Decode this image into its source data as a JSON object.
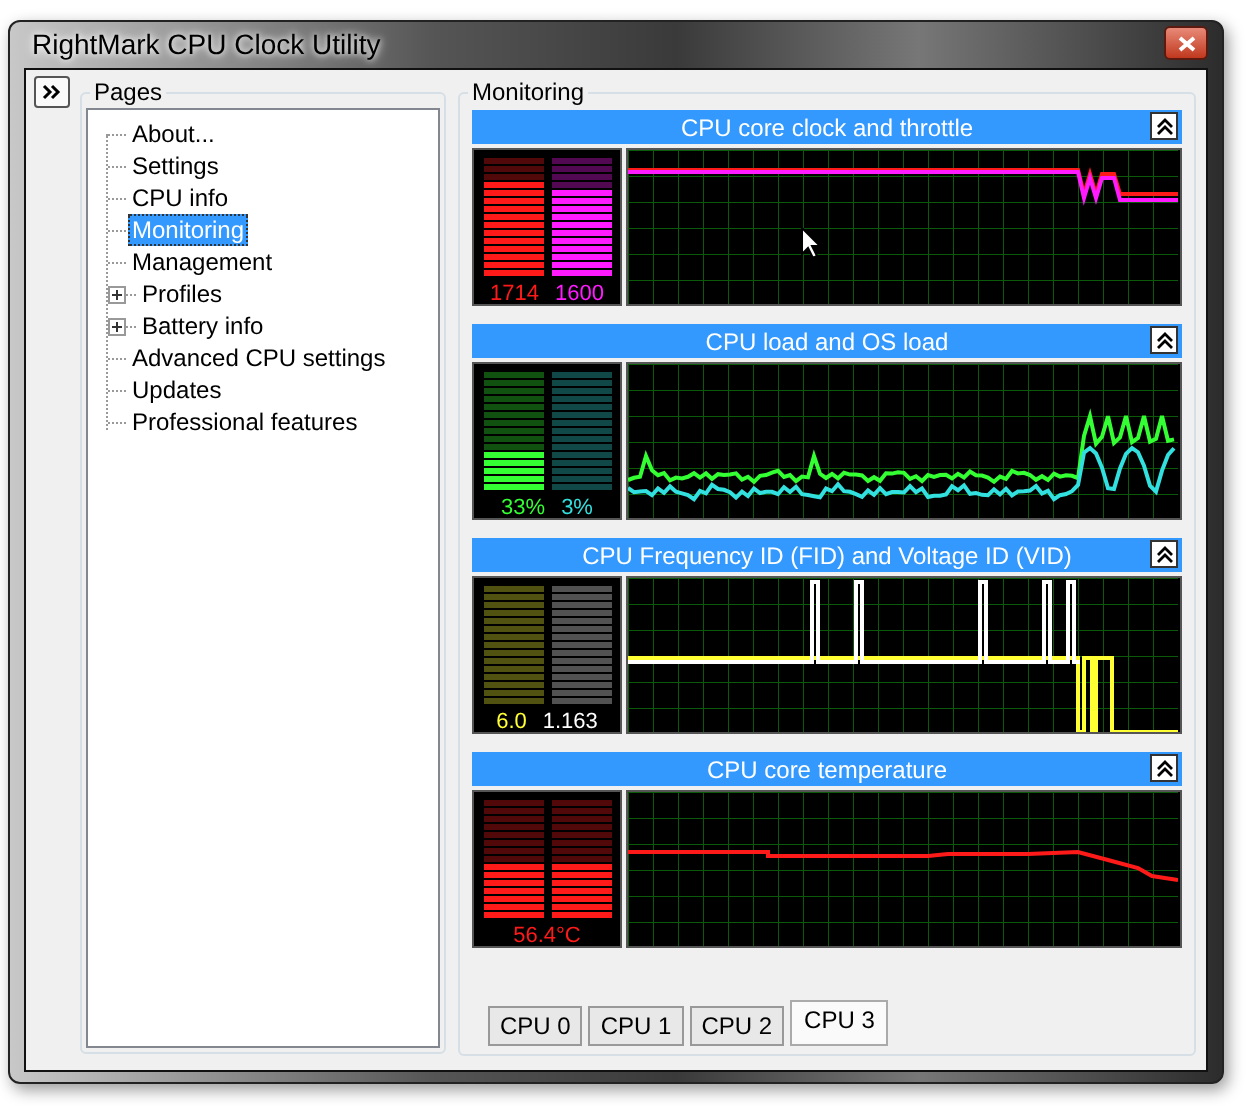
{
  "window": {
    "title": "RightMark CPU Clock Utility"
  },
  "sidebar": {
    "title": "Pages",
    "items": [
      {
        "label": "About...",
        "kind": "page",
        "selected": false
      },
      {
        "label": "Settings",
        "kind": "page",
        "selected": false
      },
      {
        "label": "CPU info",
        "kind": "page",
        "selected": false
      },
      {
        "label": "Monitoring",
        "kind": "page",
        "selected": true
      },
      {
        "label": "Management",
        "kind": "page",
        "selected": false
      },
      {
        "label": "Profiles",
        "kind": "group",
        "expanded": false,
        "selected": false
      },
      {
        "label": "Battery info",
        "kind": "group",
        "expanded": false,
        "selected": false
      },
      {
        "label": "Advanced CPU settings",
        "kind": "page",
        "selected": false
      },
      {
        "label": "Updates",
        "kind": "page",
        "selected": false
      },
      {
        "label": "Professional features",
        "kind": "page",
        "selected": false
      }
    ]
  },
  "monitoring": {
    "title": "Monitoring",
    "panels": [
      {
        "title": "CPU core clock and throttle",
        "meters": [
          {
            "reading": "1714",
            "color": "#ff1a1a",
            "level": 0.82
          },
          {
            "reading": "1600",
            "color": "#ff1aff",
            "level": 0.76
          }
        ]
      },
      {
        "title": "CPU load and OS load",
        "meters": [
          {
            "reading": "33%",
            "color": "#33ff33",
            "level": 0.3
          },
          {
            "reading": "3%",
            "color": "#33e0e0"
          }
        ]
      },
      {
        "title": "CPU Frequency ID (FID) and Voltage ID (VID)",
        "meters": [
          {
            "reading": "6.0",
            "color": "#ffff33"
          },
          {
            "reading": "1.163",
            "color": "#ffffff"
          }
        ]
      },
      {
        "title": "CPU core temperature",
        "meters": [
          {
            "reading": "56.4°C",
            "color": "#ff1a1a",
            "level": 0.45
          }
        ]
      }
    ],
    "tabs": [
      {
        "label": "CPU 0",
        "selected": false
      },
      {
        "label": "CPU 1",
        "selected": false
      },
      {
        "label": "CPU 2",
        "selected": false
      },
      {
        "label": "CPU 3",
        "selected": true
      }
    ]
  }
}
